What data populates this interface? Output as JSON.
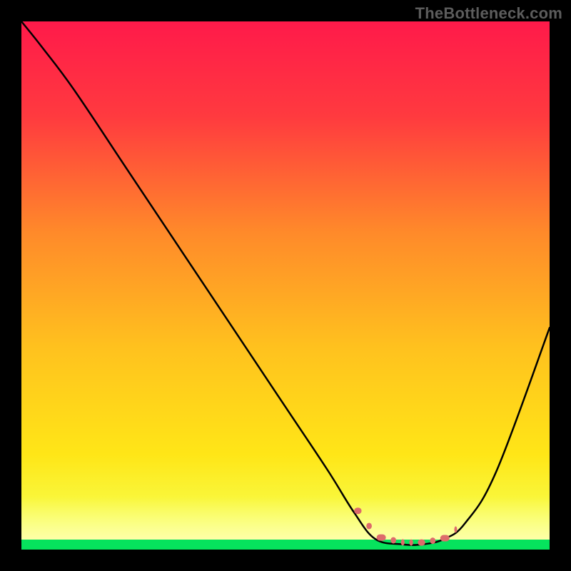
{
  "watermark": "TheBottleneck.com",
  "chart_data": {
    "type": "line",
    "title": "",
    "xlabel": "",
    "ylabel": "",
    "xlim": [
      0,
      100
    ],
    "ylim": [
      0,
      100
    ],
    "background_gradient": {
      "top_color": "#ff1a4a",
      "mid_color": "#ffd400",
      "bottom_color": "#06e35d"
    },
    "series": [
      {
        "name": "bottleneck-curve",
        "color": "#000000",
        "x": [
          0,
          4,
          10,
          20,
          30,
          40,
          50,
          58,
          63,
          67,
          72,
          76,
          80,
          84,
          90,
          100
        ],
        "values": [
          100,
          95,
          87,
          72,
          57,
          42,
          27,
          15,
          7,
          2,
          1,
          1,
          2,
          5,
          15,
          42
        ]
      }
    ],
    "flat_region": {
      "x_start": 63,
      "x_end": 82,
      "marker_color": "#dd6b6b",
      "marker_style": "dotted-blob"
    },
    "annotations": []
  }
}
